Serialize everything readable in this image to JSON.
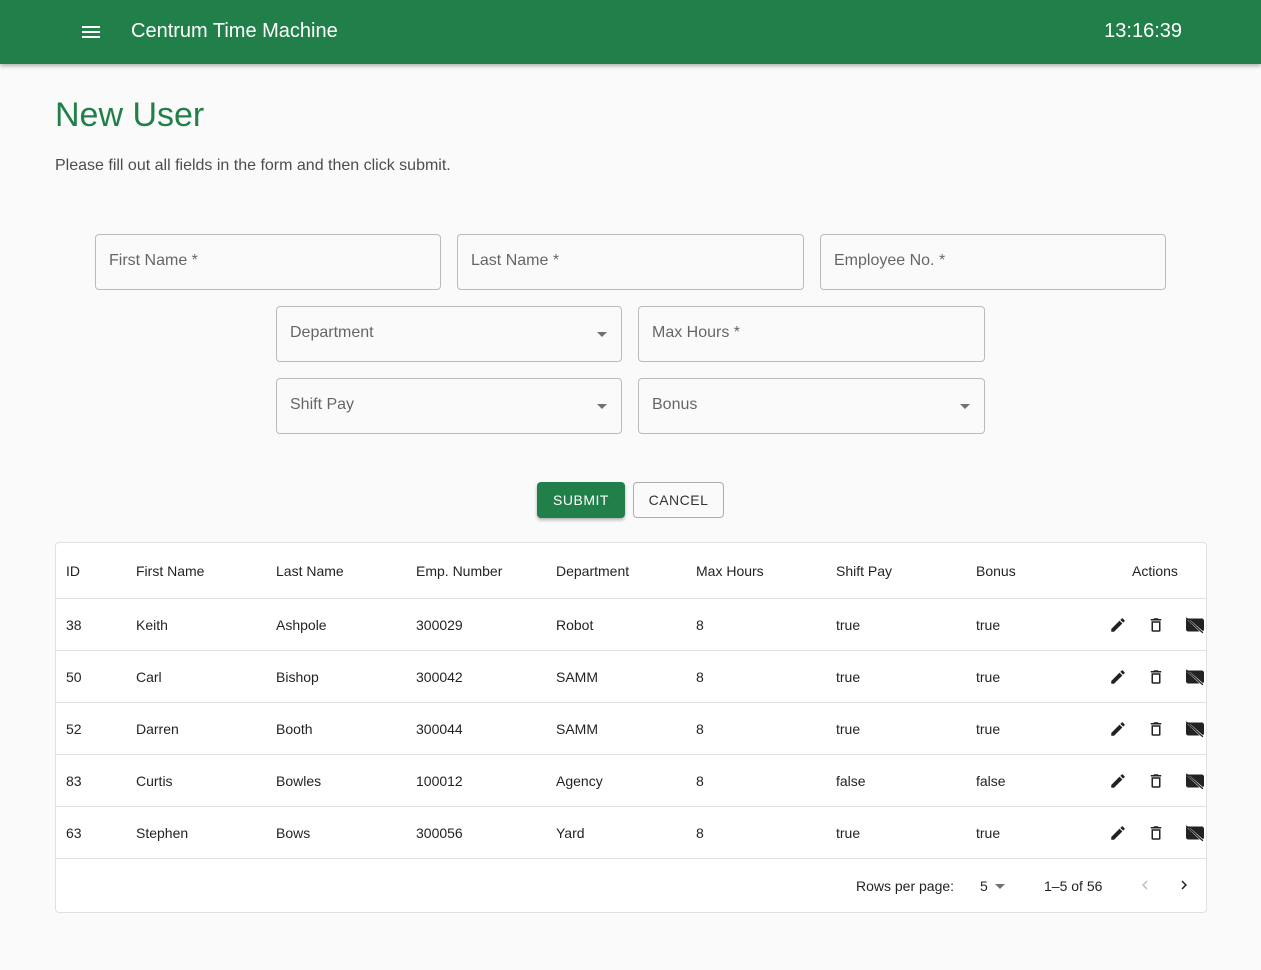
{
  "app": {
    "title": "Centrum Time Machine",
    "clock": "13:16:39",
    "accent": "#21804a"
  },
  "page": {
    "title": "New User",
    "subtitle": "Please fill out all fields in the form and then click submit."
  },
  "form": {
    "first_name": "First Name *",
    "last_name": "Last Name *",
    "employee_no": "Employee No. *",
    "department": "Department",
    "max_hours": "Max Hours *",
    "shift_pay": "Shift Pay",
    "bonus": "Bonus",
    "submit": "SUBMIT",
    "cancel": "CANCEL"
  },
  "table": {
    "headers": [
      "ID",
      "First Name",
      "Last Name",
      "Emp. Number",
      "Department",
      "Max Hours",
      "Shift Pay",
      "Bonus",
      "Actions"
    ],
    "rows": [
      [
        "38",
        "Keith",
        "Ashpole",
        "300029",
        "Robot",
        "8",
        "true",
        "true"
      ],
      [
        "50",
        "Carl",
        "Bishop",
        "300042",
        "SAMM",
        "8",
        "true",
        "true"
      ],
      [
        "52",
        "Darren",
        "Booth",
        "300044",
        "SAMM",
        "8",
        "true",
        "true"
      ],
      [
        "83",
        "Curtis",
        "Bowles",
        "100012",
        "Agency",
        "8",
        "false",
        "false"
      ],
      [
        "63",
        "Stephen",
        "Bows",
        "300056",
        "Yard",
        "8",
        "true",
        "true"
      ]
    ],
    "rows_per_page_label": "Rows per page:",
    "rows_per_page": "5",
    "range": "1–5 of 56"
  }
}
